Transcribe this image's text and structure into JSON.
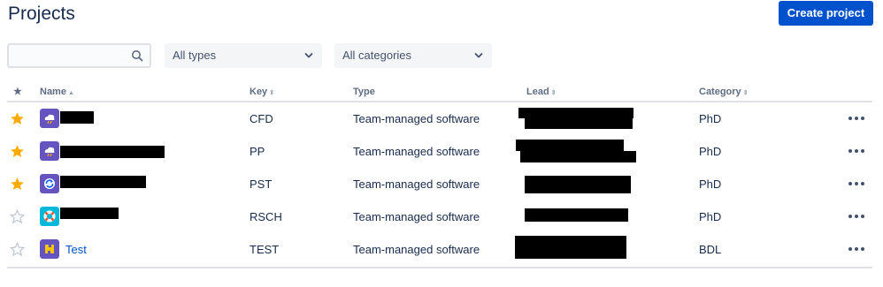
{
  "header": {
    "title": "Projects",
    "create_label": "Create project"
  },
  "filters": {
    "search_placeholder": "",
    "types_label": "All types",
    "categories_label": "All categories"
  },
  "columns": {
    "star": "★",
    "name": "Name",
    "key": "Key",
    "type": "Type",
    "lead": "Lead",
    "category": "Category"
  },
  "colors": {
    "accent": "#0052cc",
    "star_filled": "#ffab00",
    "star_empty": "#c1c7d0"
  },
  "rows": [
    {
      "starred": true,
      "icon": "cloud-icon",
      "name": "",
      "key": "CFD",
      "type": "Team-managed software",
      "category": "PhD"
    },
    {
      "starred": true,
      "icon": "cloud-icon",
      "name": "",
      "key": "PP",
      "type": "Team-managed software",
      "category": "PhD"
    },
    {
      "starred": true,
      "icon": "refresh-icon",
      "name": "",
      "key": "PST",
      "type": "Team-managed software",
      "category": "PhD"
    },
    {
      "starred": false,
      "icon": "lifebuoy-icon",
      "name": "",
      "key": "RSCH",
      "type": "Team-managed software",
      "category": "PhD"
    },
    {
      "starred": false,
      "icon": "puzzle-icon",
      "name": "Test",
      "key": "TEST",
      "type": "Team-managed software",
      "category": "BDL"
    }
  ]
}
